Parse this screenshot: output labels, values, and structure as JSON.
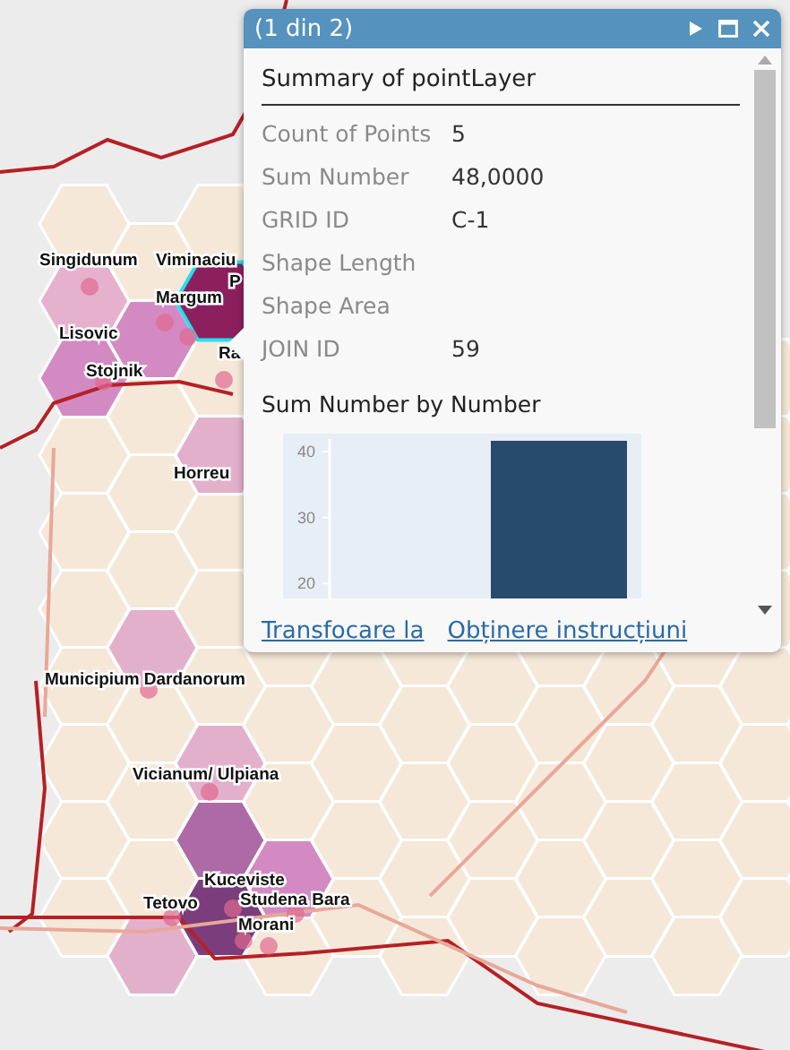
{
  "map_labels": [
    {
      "text": "Singidunum"
    },
    {
      "text": "Viminaciu"
    },
    {
      "text": "Margum"
    },
    {
      "text": "P"
    },
    {
      "text": "Lisovic"
    },
    {
      "text": "Stojnik"
    },
    {
      "text": "Ra"
    },
    {
      "text": "Horreu"
    },
    {
      "text": "Municipium Dardanorum"
    },
    {
      "text": "Vicianum/ Ulpiana"
    },
    {
      "text": "Kuceviste"
    },
    {
      "text": "Studena Bara"
    },
    {
      "text": "Tetovo"
    },
    {
      "text": "Morani"
    }
  ],
  "popup": {
    "title": "(1 din 2)",
    "heading": "Summary of pointLayer",
    "fields": [
      {
        "label": "Count of Points",
        "value": "5"
      },
      {
        "label": "Sum Number",
        "value": "48,0000"
      },
      {
        "label": "GRID ID",
        "value": "C-1"
      },
      {
        "label": "Shape Length"
      },
      {
        "label": "Shape Area"
      },
      {
        "label": "JOIN ID",
        "value": "59"
      }
    ],
    "chart_title": "Sum Number by Number",
    "chart_axis_labels": [
      "40",
      "30",
      "20"
    ],
    "actions": [
      "Transfocare la",
      "Obținere instrucțiuni"
    ]
  }
}
